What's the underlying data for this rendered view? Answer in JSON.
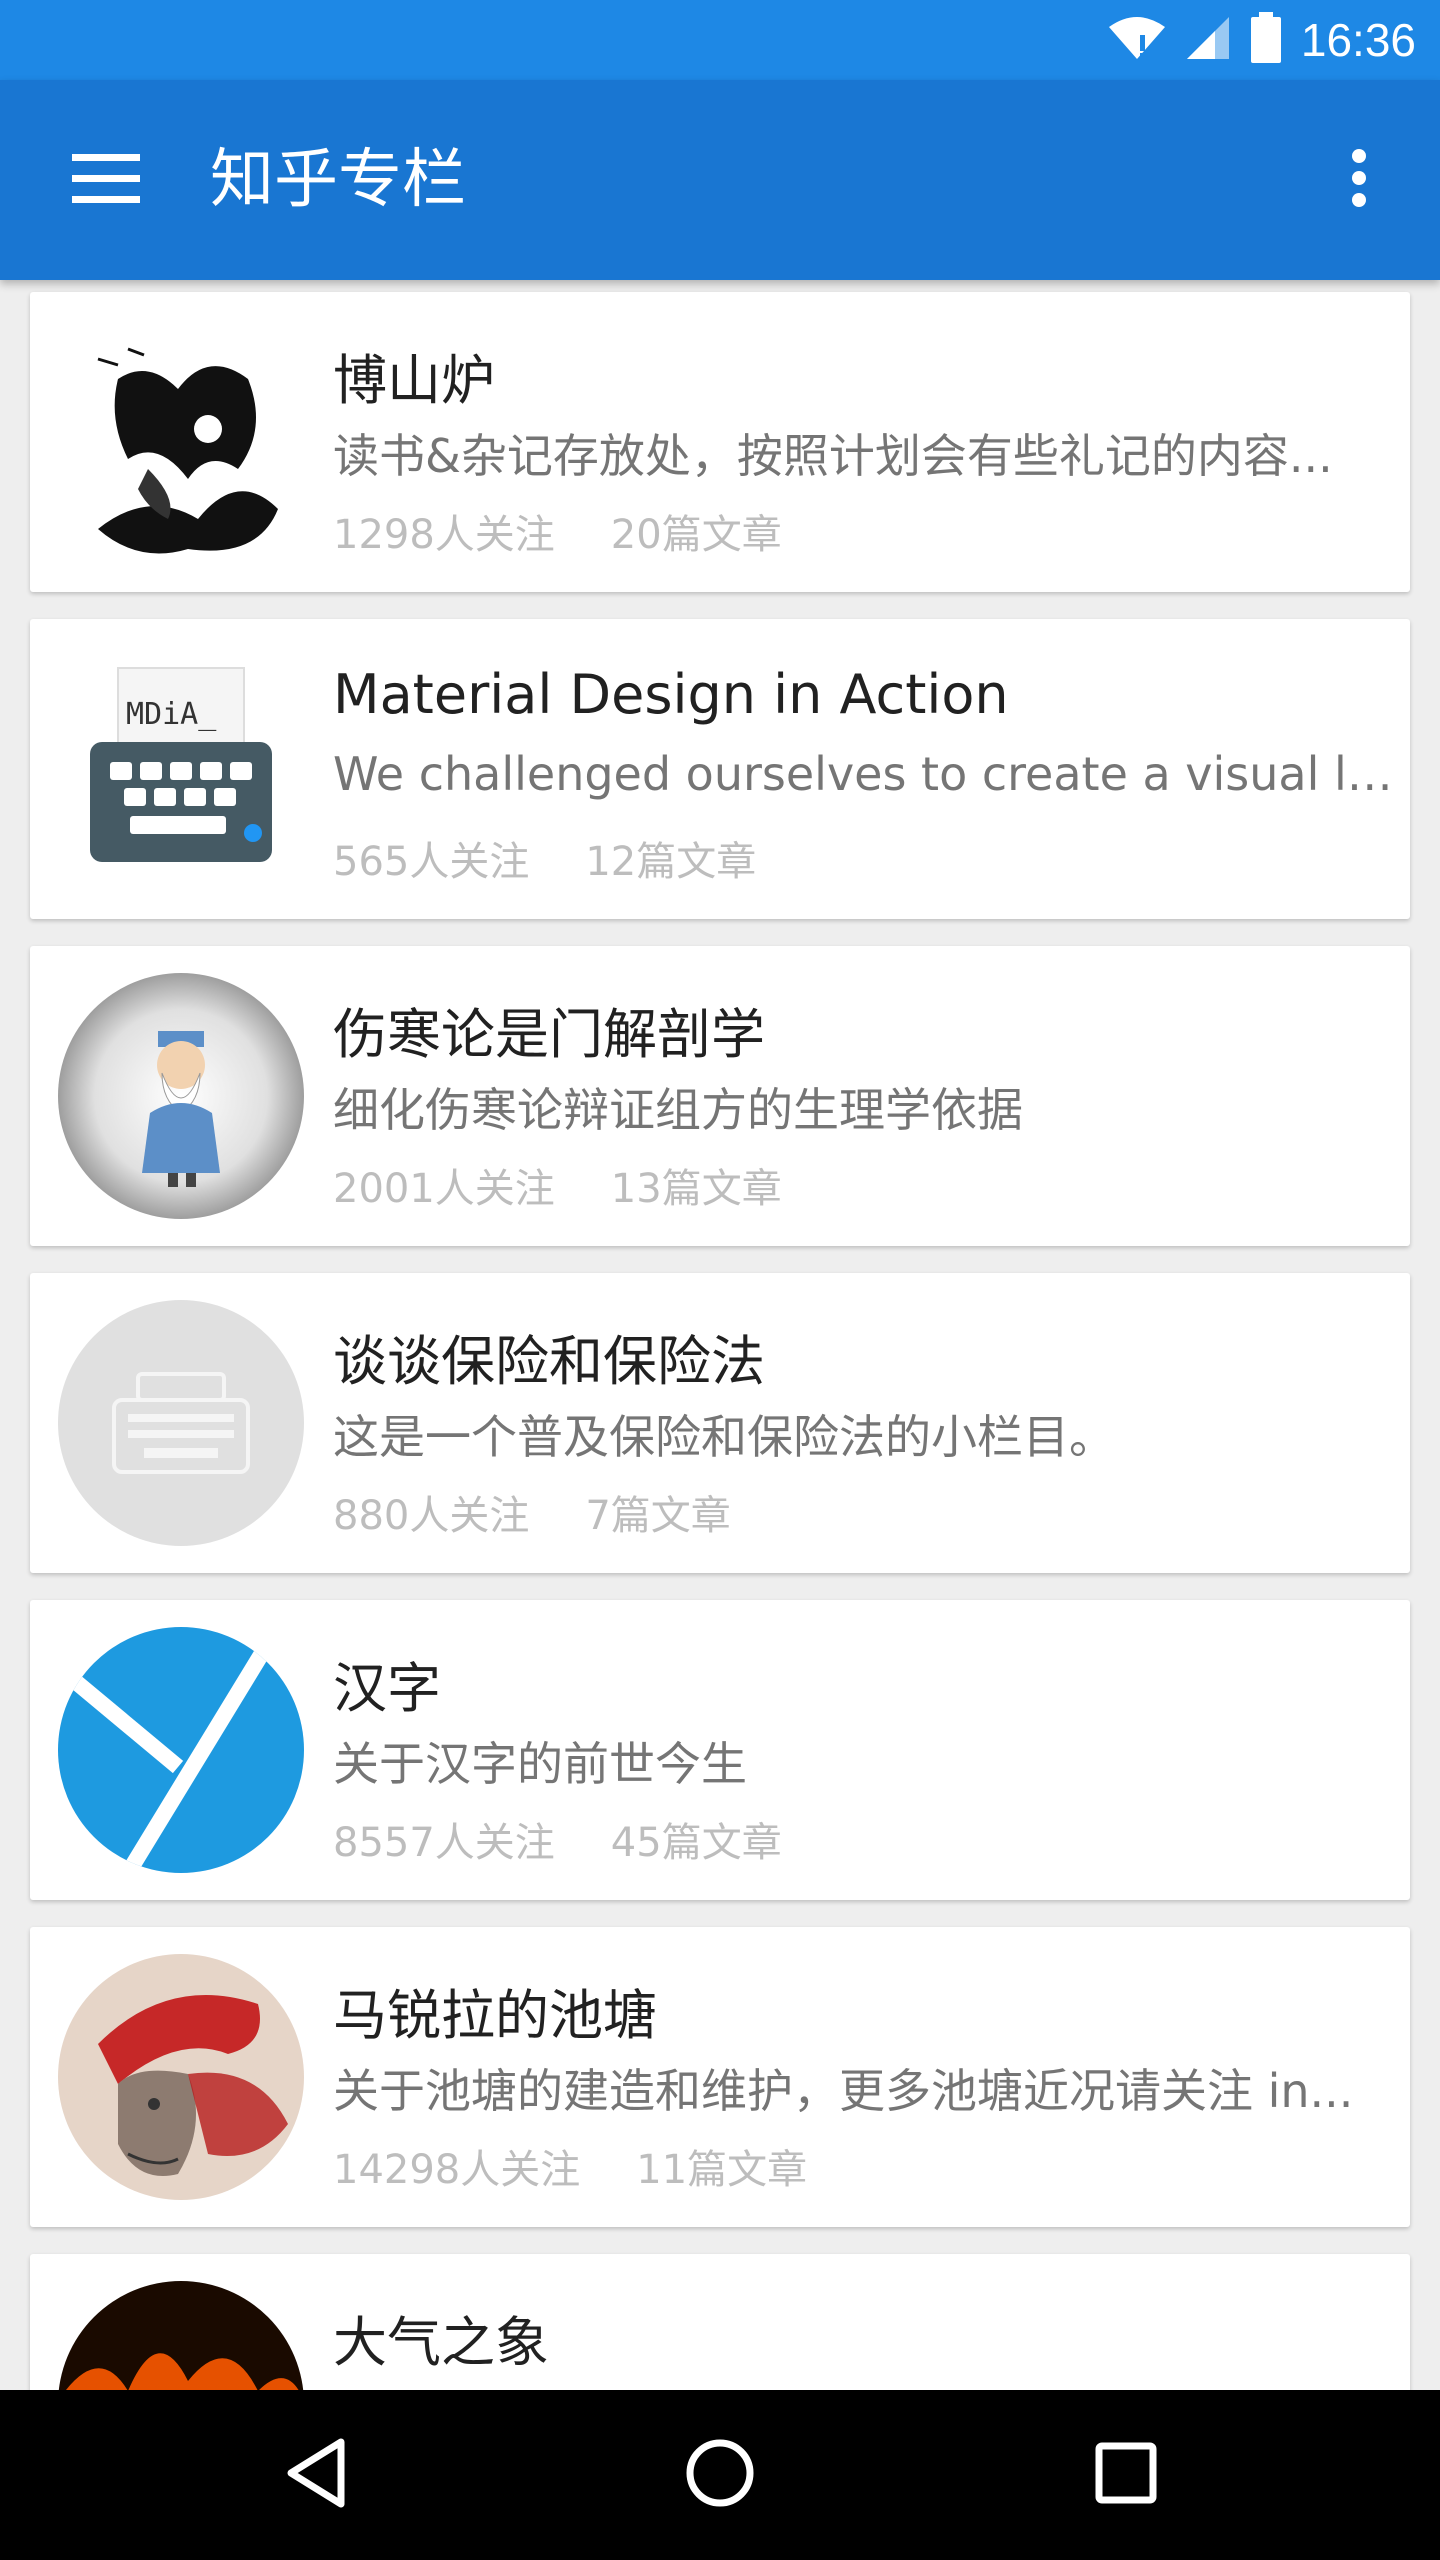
{
  "status_bar": {
    "time": "16:36",
    "icons": [
      "wifi-icon",
      "cellular-signal-icon",
      "battery-icon"
    ]
  },
  "app_bar": {
    "title": "知乎专栏",
    "menu_icon": "menu-icon",
    "overflow_icon": "more-vert-icon"
  },
  "columns": [
    {
      "title": "博山炉",
      "description": "读书&杂记存放处，按照计划会有些礼记的内容...",
      "followers": "1298人关注",
      "articles": "20篇文章",
      "avatar": "ink-painting-avatar"
    },
    {
      "title": "Material Design in Action",
      "description": "We challenged ourselves to create a visual lang...",
      "followers": "565人关注",
      "articles": "12篇文章",
      "avatar": "typewriter-keyboard-avatar",
      "avatar_text": "MDiA_"
    },
    {
      "title": "伤寒论是门解剖学",
      "description": "细化伤寒论辩证组方的生理学依据",
      "followers": "2001人关注",
      "articles": "13篇文章",
      "avatar": "sage-figure-avatar"
    },
    {
      "title": "谈谈保险和保险法",
      "description": "这是一个普及保险和保险法的小栏目。",
      "followers": "880人关注",
      "articles": "7篇文章",
      "avatar": "typewriter-placeholder-avatar"
    },
    {
      "title": "汉字",
      "description": "关于汉字的前世今生",
      "followers": "8557人关注",
      "articles": "45篇文章",
      "avatar": "blue-y-logo-avatar"
    },
    {
      "title": "马锐拉的池塘",
      "description": "关于池塘的建造和维护，更多池塘近况请关注 in...",
      "followers": "14298人关注",
      "articles": "11篇文章",
      "avatar": "red-hat-sketch-avatar"
    },
    {
      "title": "大气之象",
      "description": "",
      "followers": "",
      "articles": "",
      "avatar": "fire-avatar"
    }
  ],
  "nav_bar": {
    "buttons": [
      "back-icon",
      "home-icon",
      "recents-icon"
    ]
  },
  "colors": {
    "status_bar": "#1e88e5",
    "app_bar": "#1976d2",
    "background": "#eeeeee"
  }
}
